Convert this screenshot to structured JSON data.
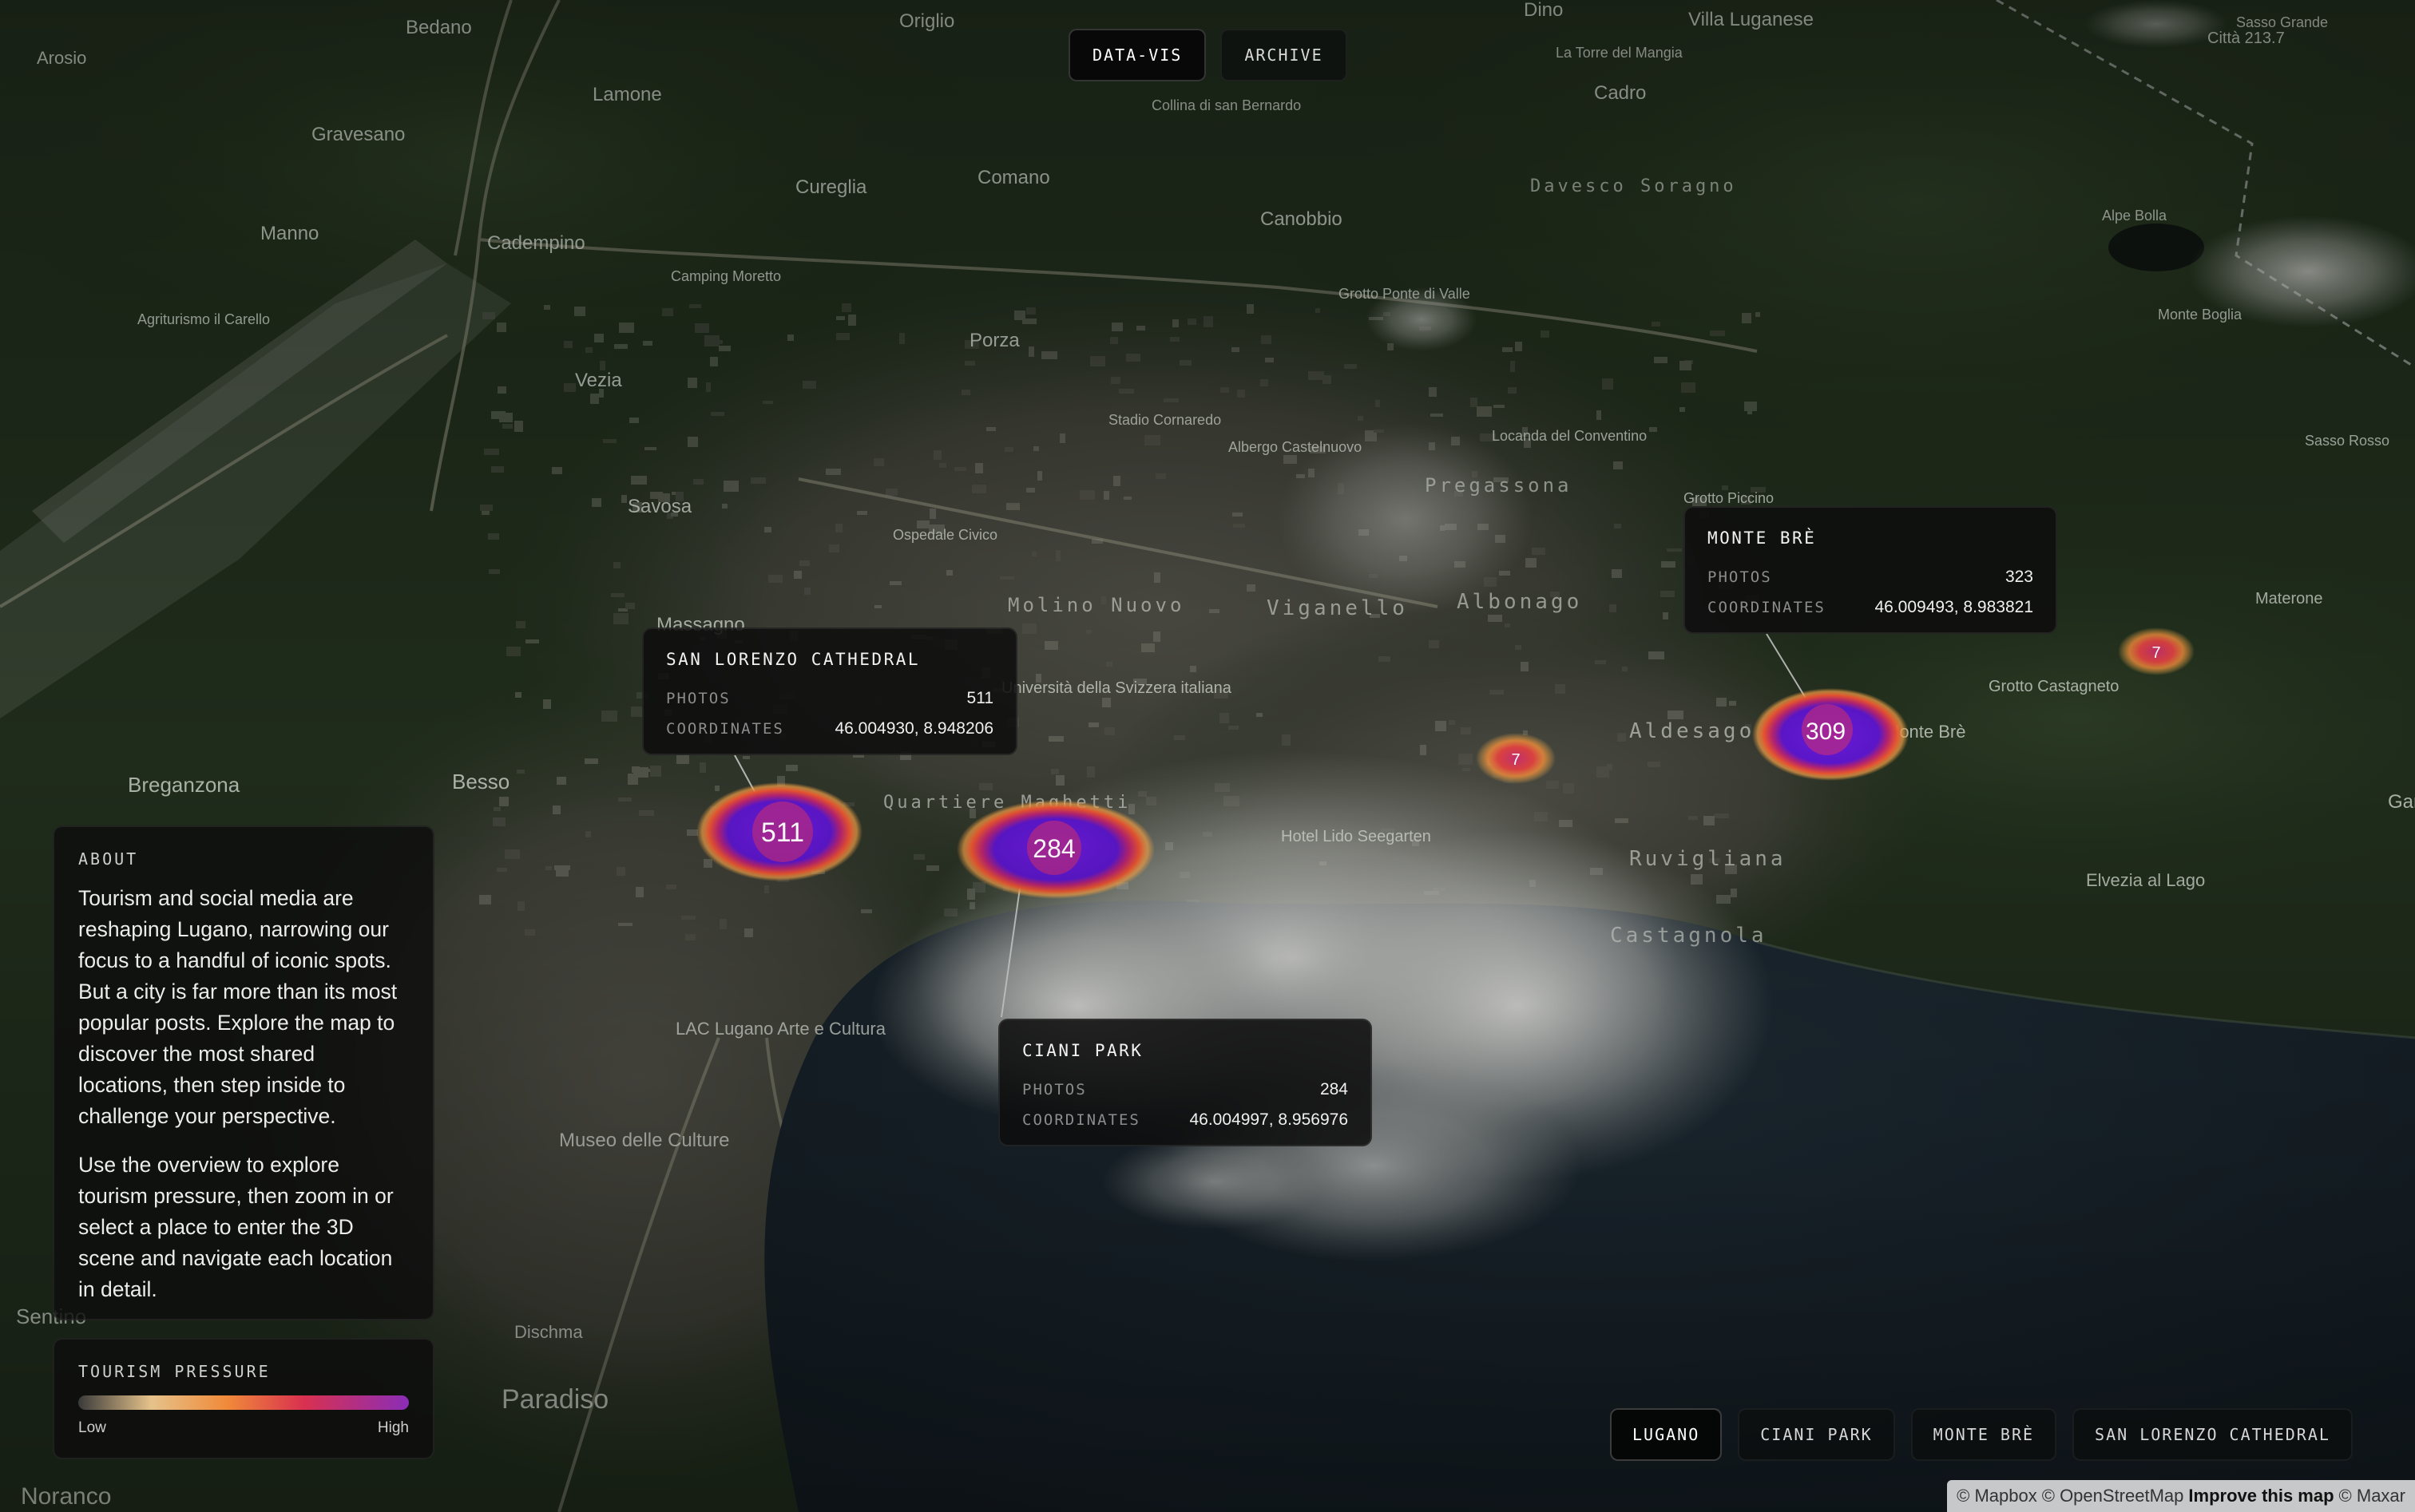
{
  "nav": {
    "tabs": [
      {
        "label": "DATA-VIS",
        "active": true
      },
      {
        "label": "ARCHIVE",
        "active": false
      }
    ]
  },
  "hotspots": [
    {
      "name": "San Lorenzo Cathedral",
      "count": "511"
    },
    {
      "name": "Ciani Park",
      "count": "284"
    },
    {
      "name": "Monte Brè",
      "count": "309"
    },
    {
      "name": "unnamed-east-1",
      "count": "7"
    },
    {
      "name": "unnamed-east-2",
      "count": "7"
    }
  ],
  "tooltips": [
    {
      "title": "SAN LORENZO CATHEDRAL",
      "photos_label": "PHOTOS",
      "photos": "511",
      "coords_label": "COORDINATES",
      "coords": "46.004930, 8.948206"
    },
    {
      "title": "CIANI PARK",
      "photos_label": "PHOTOS",
      "photos": "284",
      "coords_label": "COORDINATES",
      "coords": "46.004997, 8.956976"
    },
    {
      "title": "MONTE BRÈ",
      "photos_label": "PHOTOS",
      "photos": "323",
      "coords_label": "COORDINATES",
      "coords": "46.009493, 8.983821"
    }
  ],
  "about": {
    "heading": "ABOUT",
    "p1": "Tourism and social media are reshaping Lugano, narrowing our focus to a handful of iconic spots. But a city is far more than its most popular posts. Explore the map to discover the most shared locations, then step inside to challenge your perspective.",
    "p2": "Use the overview to explore tourism pressure, then zoom in or select a place to enter the 3D scene and navigate each location in detail."
  },
  "legend": {
    "heading": "TOURISM PRESSURE",
    "low": "Low",
    "high": "High"
  },
  "locations": [
    {
      "label": "LUGANO",
      "active": true
    },
    {
      "label": "CIANI PARK",
      "active": false
    },
    {
      "label": "MONTE BRÈ",
      "active": false
    },
    {
      "label": "SAN LORENZO CATHEDRAL",
      "active": false
    }
  ],
  "attribution": {
    "mapbox": "© Mapbox",
    "osm": "© OpenStreetMap",
    "improve": "Improve this map",
    "maxar": "© Maxar"
  },
  "map_labels": {
    "places": [
      "Bedano",
      "Origlio",
      "Dino",
      "Villa Luganese",
      "Arosio",
      "Gravesano",
      "Lamone",
      "Cureglia",
      "Comano",
      "Canobbio",
      "Cadro",
      "Manno",
      "Cadempino",
      "Porza",
      "Vezia",
      "Savosa",
      "Massagno",
      "Breganzona",
      "Besso",
      "Paradiso",
      "Noranco",
      "Sentino",
      "Alpe Bolla",
      "Monte Boglia",
      "Sasso Rosso",
      "Materone",
      "Grotto Castagneto",
      "Elvezia al Lago",
      "Hotel Lido Seegarten",
      "Museo delle Culture",
      "LAC Lugano Arte e Cultura",
      "Pregassona",
      "Viganello",
      "Albonago",
      "Aldesago",
      "Ruvigliana",
      "Castagnola",
      "Davesco Soragno",
      "Molino Nuovo",
      "Quartiere Maghetti",
      "Grotto Piccino",
      "Locanda del Conventino",
      "Stadio Cornaredo",
      "Albergo Castelnuovo",
      "Ospedale Civico",
      "Collina di san Bernardo",
      "La Torre del Mangia",
      "Grotto Ponte di Valle",
      "Camping Moretto",
      "Agriturismo il Carello",
      "Dischma",
      "Sasso Grande",
      "Città 213.7",
      "Università della Svizzera italiana",
      "Monte Brè",
      "Gand"
    ]
  }
}
